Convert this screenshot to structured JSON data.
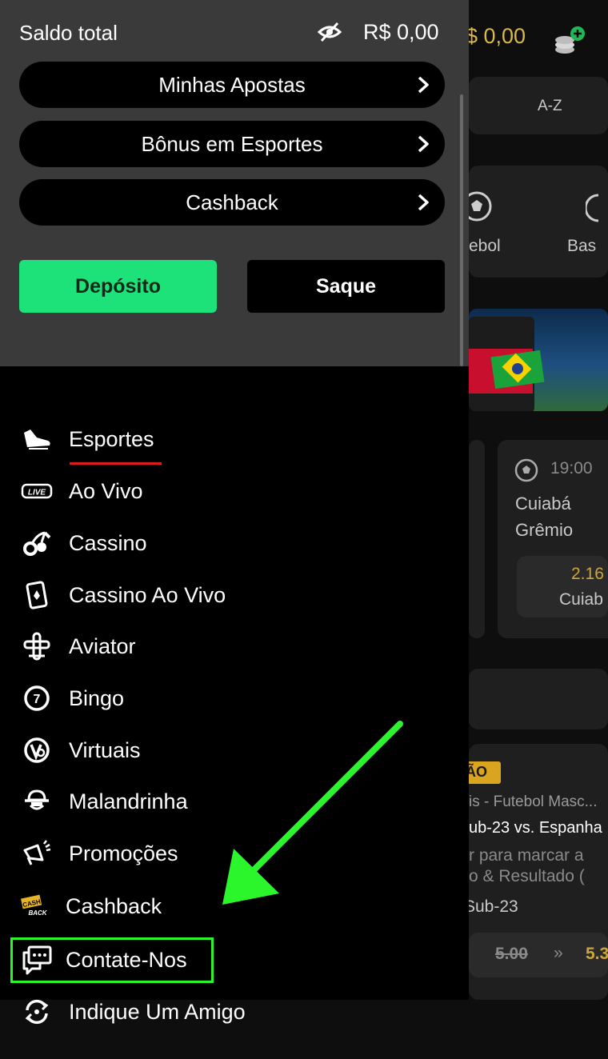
{
  "background": {
    "balance": "$ 0,00",
    "sort_label": "A-Z",
    "sport_futebol": "ebol",
    "sport_basquete": "Bas",
    "match": {
      "time": "19:00",
      "team_home": "Cuiabá",
      "team_away": "Grêmio",
      "odd_value": "2.16",
      "odd_label": "Cuiab"
    },
    "promo": {
      "badge": "ÃO",
      "league": "is - Futebol Masc...",
      "fixture": "ub-23 vs. Espanha",
      "line1": "r para marcar a",
      "line2": "o & Resultado (",
      "team": "Sub-23",
      "old_odd": "5.00",
      "new_odd": "5.3"
    }
  },
  "wallet": {
    "label": "Saldo total",
    "value": "R$ 0,00"
  },
  "links": [
    {
      "label": "Minhas Apostas"
    },
    {
      "label": "Bônus em Esportes"
    },
    {
      "label": "Cashback"
    }
  ],
  "actions": {
    "deposit": "Depósito",
    "withdraw": "Saque"
  },
  "colors": {
    "deposit_bg": "#1de27a",
    "active_underline": "#e01b1b",
    "highlight": "#2bf52b"
  },
  "menu": [
    {
      "label": "Esportes",
      "icon": "sports-shoe-icon"
    },
    {
      "label": "Ao Vivo",
      "icon": "live-icon"
    },
    {
      "label": "Cassino",
      "icon": "cherries-icon"
    },
    {
      "label": "Cassino Ao Vivo",
      "icon": "card-icon"
    },
    {
      "label": "Aviator",
      "icon": "airplane-icon"
    },
    {
      "label": "Bingo",
      "icon": "bingo-ball-icon"
    },
    {
      "label": "Virtuais",
      "icon": "virtual-icon"
    },
    {
      "label": "Malandrinha",
      "icon": "hat-icon"
    },
    {
      "label": "Promoções",
      "icon": "megaphone-icon"
    },
    {
      "label": "Cashback",
      "icon": "cashback-icon"
    },
    {
      "label": "Contate-Nos",
      "icon": "chat-icon"
    },
    {
      "label": "Indique Um Amigo",
      "icon": "refer-icon"
    }
  ]
}
